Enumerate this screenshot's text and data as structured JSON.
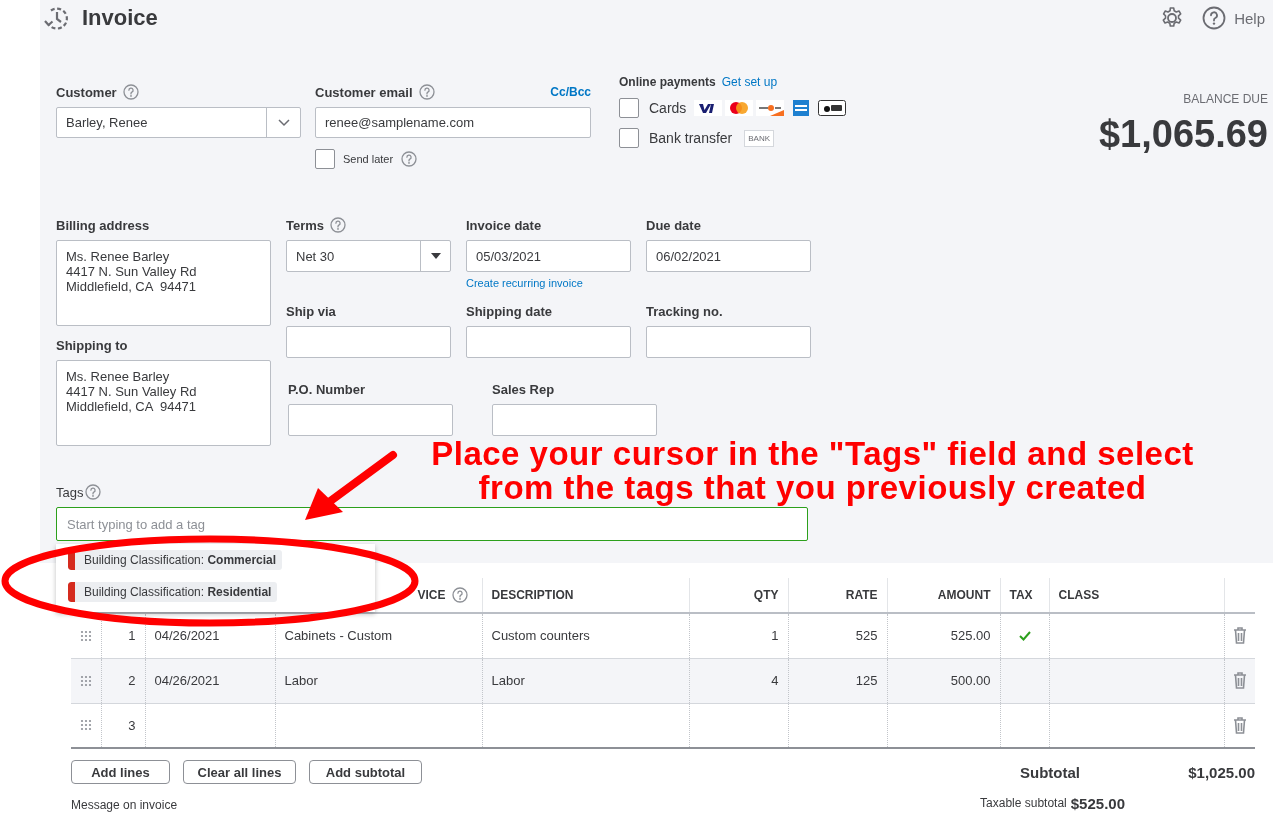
{
  "header": {
    "title": "Invoice",
    "help_label": "Help"
  },
  "customer": {
    "label": "Customer",
    "value": "Barley, Renee"
  },
  "email": {
    "label": "Customer email",
    "value": "renee@samplename.com",
    "cc_bcc": "Cc/Bcc",
    "send_later": {
      "label": "Send later",
      "checked": false
    }
  },
  "online_payments": {
    "label": "Online payments",
    "link": "Get set up",
    "options": [
      {
        "kind": "cards",
        "label": "Cards",
        "checked": false
      },
      {
        "kind": "bank",
        "label": "Bank transfer",
        "checked": false,
        "badge": "BANK"
      }
    ]
  },
  "balance": {
    "label": "BALANCE DUE",
    "amount": "$1,065.69"
  },
  "billing_address": {
    "label": "Billing address",
    "value": "Ms. Renee Barley\n4417 N. Sun Valley Rd\nMiddlefield, CA  94471"
  },
  "shipping_to": {
    "label": "Shipping to",
    "value": "Ms. Renee Barley\n4417 N. Sun Valley Rd\nMiddlefield, CA  94471"
  },
  "terms": {
    "label": "Terms",
    "value": "Net 30"
  },
  "invoice_date": {
    "label": "Invoice date",
    "value": "05/03/2021",
    "link": "Create recurring invoice"
  },
  "due_date": {
    "label": "Due date",
    "value": "06/02/2021"
  },
  "ship_via": {
    "label": "Ship via"
  },
  "shipping_date": {
    "label": "Shipping date"
  },
  "tracking_no": {
    "label": "Tracking no."
  },
  "po_number": {
    "label": "P.O. Number"
  },
  "sales_rep": {
    "label": "Sales Rep"
  },
  "tags": {
    "label": "Tags",
    "placeholder": "Start typing to add a tag",
    "focused": true,
    "options": [
      {
        "text": "Building Classification: **Commercial**"
      },
      {
        "text": "Building Classification: **Residential**"
      }
    ]
  },
  "table": {
    "columns": [
      "VICE",
      "DESCRIPTION",
      "QTY",
      "RATE",
      "AMOUNT",
      "TAX",
      "CLASS"
    ],
    "rows": [
      {
        "num": "1",
        "date": "04/26/2021",
        "product": "Cabinets - Custom",
        "description": "Custom counters",
        "qty": "1",
        "rate": "525",
        "amount": "525.00",
        "taxable": true,
        "hovered": false
      },
      {
        "num": "2",
        "date": "04/26/2021",
        "product": "Labor",
        "description": "Labor",
        "qty": "4",
        "rate": "125",
        "amount": "500.00",
        "taxable": false,
        "hovered": true
      },
      {
        "num": "3",
        "taxable": false,
        "hovered": false
      }
    ]
  },
  "buttons": [
    "Add lines",
    "Clear all lines",
    "Add subtotal"
  ],
  "totals": {
    "subtotal_label": "Subtotal",
    "subtotal": "$1,025.00",
    "taxable_label": "Taxable subtotal",
    "taxable": "$525.00"
  },
  "message_label": "Message on invoice",
  "annotation": {
    "lines": [
      "Place your cursor in the \"Tags\" field and select",
      "from the tags that you previously created"
    ]
  }
}
